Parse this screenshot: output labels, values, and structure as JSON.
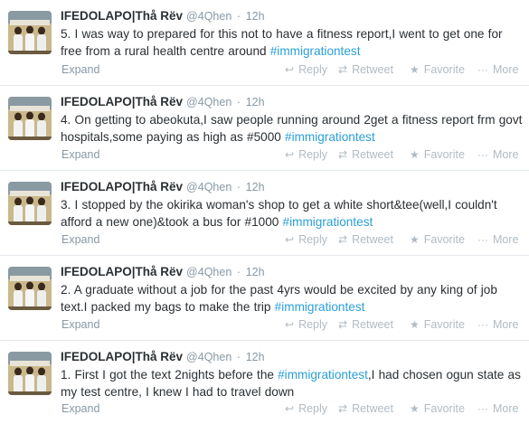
{
  "actions": {
    "expand": "Expand",
    "reply": "Reply",
    "retweet": "Retweet",
    "favorite": "Favorite",
    "more": "More"
  },
  "colors": {
    "hashtag": "#2a9fd6",
    "name": "#292f33",
    "meta": "#8899a6",
    "action": "#b1bbc3"
  },
  "icons": {
    "reply": "reply-icon",
    "retweet": "retweet-icon",
    "favorite": "star-icon",
    "more": "more-dots-icon"
  },
  "tweets": [
    {
      "name": "IFEDOLAPO|Thå Rëv",
      "handle": "@4Qhen",
      "dot": "·",
      "time": "12h",
      "text_before": "5. I was way to prepared for this not to have a fitness report,I went to get one for free from a rural health centre around ",
      "hashtag": "#immigrationtest",
      "text_after": ""
    },
    {
      "name": "IFEDOLAPO|Thå Rëv",
      "handle": "@4Qhen",
      "dot": "·",
      "time": "12h",
      "text_before": "4. On getting to abeokuta,I saw people running around 2get a fitness report frm govt hospitals,some paying as high as #5000 ",
      "hashtag": "#immigrationtest",
      "text_after": ""
    },
    {
      "name": "IFEDOLAPO|Thå Rëv",
      "handle": "@4Qhen",
      "dot": "·",
      "time": "12h",
      "text_before": "3. I stopped by the okirika woman's shop to get a white short&tee(well,I couldn't afford a new one)&took a bus for #1000 ",
      "hashtag": "#immigrationtest",
      "text_after": ""
    },
    {
      "name": "IFEDOLAPO|Thå Rëv",
      "handle": "@4Qhen",
      "dot": "·",
      "time": "12h",
      "text_before": "2. A graduate without a job for the past 4yrs would be excited by any king of job text.I packed my bags to make the trip ",
      "hashtag": "#immigrationtest",
      "text_after": ""
    },
    {
      "name": "IFEDOLAPO|Thå Rëv",
      "handle": "@4Qhen",
      "dot": "·",
      "time": "12h",
      "text_before": "1. First I got the text 2nights before the ",
      "hashtag": "#immigrationtest",
      "text_after": ",I had chosen ogun state as my test centre, I knew I had to travel down"
    }
  ]
}
